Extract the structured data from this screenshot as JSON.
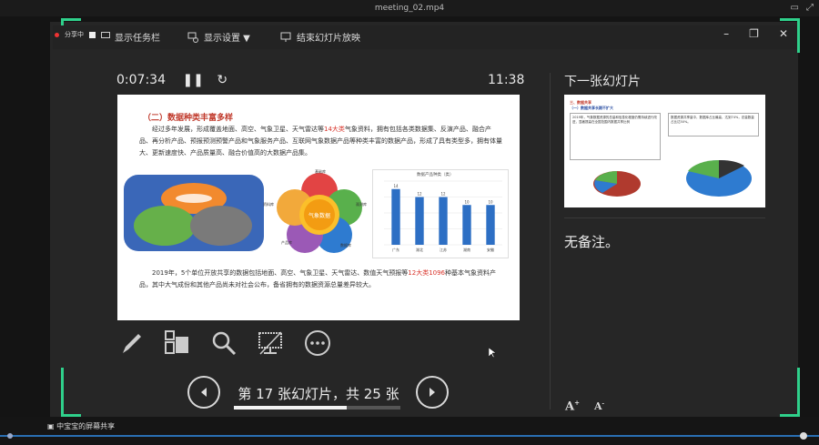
{
  "window": {
    "title": "meeting_02.mp4"
  },
  "toolbar": {
    "rec_label": "分享中",
    "taskbar_label": "显示任务栏",
    "settings_label": "显示设置 ▼",
    "end_label": "结束幻灯片放映"
  },
  "presenter": {
    "timer": "0:07:34",
    "clock": "11:38",
    "next_title": "下一张幻灯片",
    "notes": "无备注。",
    "slide_counter": "第 17 张幻灯片，共 25 张",
    "progress": 0.68,
    "font_up": "A",
    "font_down": "A"
  },
  "slide": {
    "title": "（二）数据种类丰富多样",
    "p1_a": "经过多年发展，形成覆盖地面、高空、气象卫星、天气雷达等",
    "p1_red": "14大类",
    "p1_b": "气象资料，拥有包括各类数据集、反演产品、融合产品、再分析产品、预报预测预警产品和气象服务产品、互联网气象数据产品等种类丰富的数据产品，形成了具有类型多，拥有体量大、更新速度快、产品质量高、融合价值高的大数据产品集。",
    "diagram_center": "气象数据",
    "petal_labels": [
      "基础库",
      "观测库",
      "数据库",
      "产品库",
      "资料库",
      "专题库"
    ],
    "chart_title": "数据产品种类（类）",
    "p2_a": "2019年，5个单位开放共享的数据包括地面、高空、气象卫星、天气雷达、数值天气预报等",
    "p2_red": "12大类1096",
    "p2_b": "种基本气象资料产品，其中大气成份和其他产品尚未对社会公布，备省拥有的数据资源总量差异较大。",
    "chart_data": {
      "type": "bar",
      "categories": [
        "广东",
        "湖北",
        "江苏",
        "湖南",
        "安徽"
      ],
      "values": [
        14,
        12,
        12,
        10,
        10
      ],
      "ylim": [
        0,
        16
      ]
    }
  },
  "next_slide": {
    "heading": "三、数据共享",
    "sub": "（一）数据共享长期不扩大",
    "left_text": "2019年，气象数据资源的总量和信息化程度仍需持续进行改进，显著提高在全国范围内数据共享比例",
    "right_text": "数据资源共享量中，数据库占比最高，达到74%，总量数量占比达50%。"
  },
  "bottom": {
    "share_label": "中宝宝的屏幕共享"
  },
  "colors": {
    "accent": "#2fd08b",
    "seek": "#2a6fb3"
  }
}
